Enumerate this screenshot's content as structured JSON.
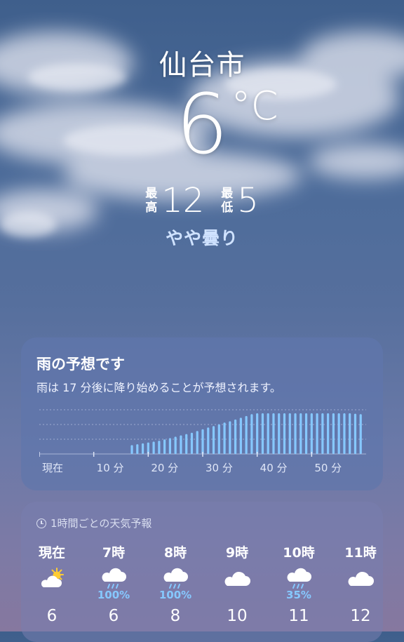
{
  "city": "仙台市",
  "temperature": "6",
  "unit": "°C",
  "high": {
    "label_top": "最",
    "label_bottom": "高",
    "value": "12"
  },
  "low": {
    "label_top": "最",
    "label_bottom": "低",
    "value": "5"
  },
  "condition": "やや曇り",
  "rain_forecast": {
    "title": "雨の予想です",
    "subtitle": "雨は 17 分後に降り始めることが予想されます。",
    "tick_labels": [
      "現在",
      "10 分",
      "20 分",
      "30 分",
      "40 分",
      "50 分"
    ],
    "chart_data": {
      "type": "bar",
      "x": [
        17,
        18,
        19,
        20,
        21,
        22,
        23,
        24,
        25,
        26,
        27,
        28,
        29,
        30,
        31,
        32,
        33,
        34,
        35,
        36,
        37,
        38,
        39,
        40,
        41,
        42,
        43,
        44,
        45,
        46,
        47,
        48,
        49,
        50,
        51,
        52,
        53,
        54,
        55,
        56,
        57,
        58,
        59
      ],
      "values": [
        0.2,
        0.22,
        0.24,
        0.26,
        0.28,
        0.3,
        0.33,
        0.36,
        0.39,
        0.42,
        0.45,
        0.48,
        0.52,
        0.56,
        0.6,
        0.63,
        0.67,
        0.71,
        0.74,
        0.78,
        0.82,
        0.86,
        0.9,
        0.92,
        0.92,
        0.92,
        0.92,
        0.92,
        0.92,
        0.92,
        0.92,
        0.92,
        0.92,
        0.92,
        0.92,
        0.92,
        0.92,
        0.92,
        0.92,
        0.92,
        0.92,
        0.91,
        0.9
      ],
      "xlim": [
        0,
        60
      ],
      "ylim": [
        0,
        1
      ]
    }
  },
  "hourly": {
    "header": "1時間ごとの天気予報",
    "items": [
      {
        "time": "現在",
        "icon": "partly-sunny-icon",
        "pct": "",
        "temp": "6"
      },
      {
        "time": "7時",
        "icon": "rain-cloud-icon",
        "pct": "100%",
        "temp": "6"
      },
      {
        "time": "8時",
        "icon": "rain-cloud-icon",
        "pct": "100%",
        "temp": "8"
      },
      {
        "time": "9時",
        "icon": "cloud-icon",
        "pct": "",
        "temp": "10"
      },
      {
        "time": "10時",
        "icon": "rain-cloud-icon",
        "pct": "35%",
        "temp": "11"
      },
      {
        "time": "11時",
        "icon": "cloud-icon",
        "pct": "",
        "temp": "12"
      }
    ]
  },
  "colors": {
    "precip": "#86c8ff",
    "condition": "#cfe2ff"
  }
}
